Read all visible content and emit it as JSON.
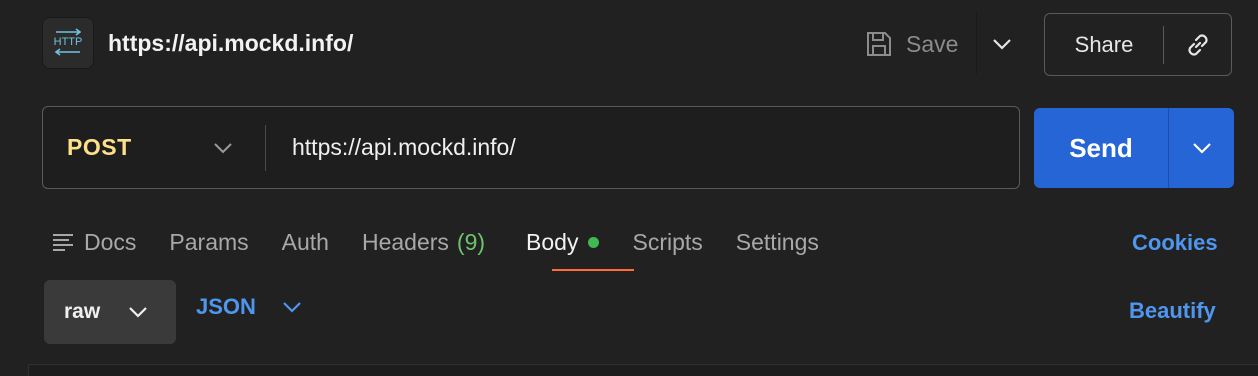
{
  "request": {
    "icon": "http-icon",
    "icon_text": "HTTP",
    "title": "https://api.mockd.info/"
  },
  "header": {
    "save_label": "Save",
    "share_label": "Share"
  },
  "url_bar": {
    "method": "POST",
    "url": "https://api.mockd.info/"
  },
  "send": {
    "label": "Send"
  },
  "tabs": [
    {
      "label": "Docs",
      "icon": "docs-icon"
    },
    {
      "label": "Params"
    },
    {
      "label": "Auth"
    },
    {
      "label": "Headers",
      "count": "(9)"
    },
    {
      "label": "Body",
      "active": true,
      "indicator": "green-dot"
    },
    {
      "label": "Scripts"
    },
    {
      "label": "Settings"
    }
  ],
  "cookies_label": "Cookies",
  "body": {
    "mode": "raw",
    "language": "JSON",
    "beautify_label": "Beautify"
  },
  "colors": {
    "method": "#ffe08a",
    "accent_blue": "#4f96ee",
    "send_bg": "#2565d6",
    "active_underline": "#ff6c37",
    "status_dot": "#3fb950"
  }
}
